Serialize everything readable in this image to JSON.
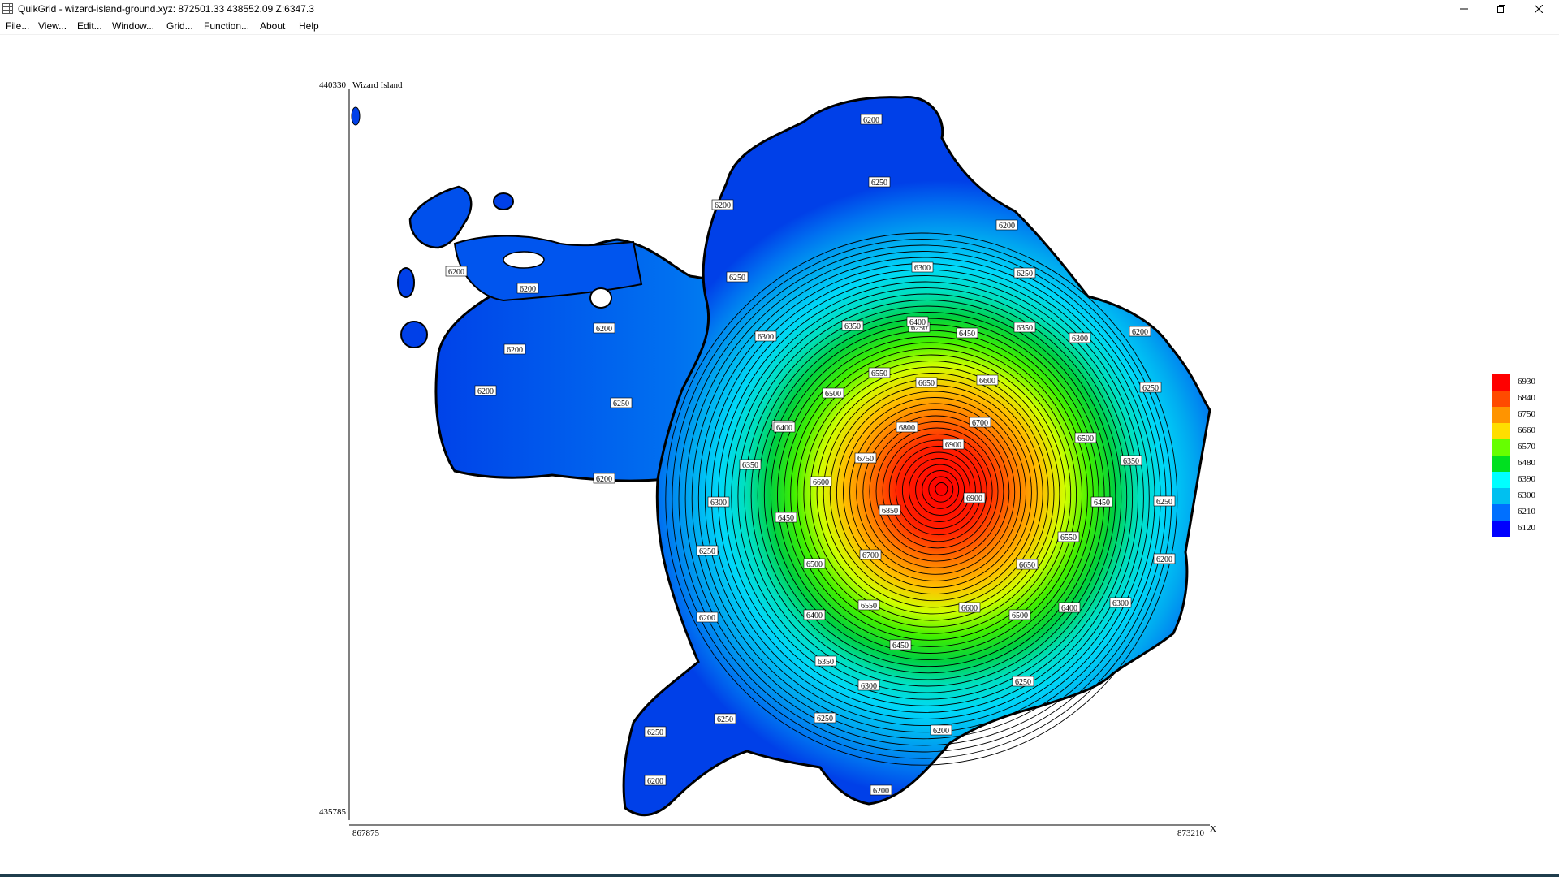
{
  "window": {
    "title": "QuikGrid - wizard-island-ground.xyz: 872501.33 438552.09 Z:6347.3",
    "app_icon": "grid-icon",
    "controls": {
      "minimize_icon": "minimize-icon",
      "restore_icon": "restore-icon",
      "close_icon": "close-icon"
    }
  },
  "menu": {
    "items": [
      {
        "label": "File...",
        "name": "menu-file"
      },
      {
        "label": "View...",
        "name": "menu-view"
      },
      {
        "label": "Edit...",
        "name": "menu-edit"
      },
      {
        "label": "Window...",
        "name": "menu-window"
      },
      {
        "label": "Grid...",
        "name": "menu-grid"
      },
      {
        "label": "Function...",
        "name": "menu-function"
      },
      {
        "label": "About",
        "name": "menu-about"
      },
      {
        "label": "Help",
        "name": "menu-help"
      }
    ]
  },
  "plot": {
    "title": "Wizard Island",
    "y_max_label": "440330",
    "y_min_label": "435785",
    "x_min_label": "867875",
    "x_max_label": "873210",
    "x_axis_name": "X"
  },
  "legend": {
    "entries": [
      {
        "value": "6930",
        "color": "#ff0000"
      },
      {
        "value": "6840",
        "color": "#ff4a00"
      },
      {
        "value": "6750",
        "color": "#ff9400"
      },
      {
        "value": "6660",
        "color": "#ffde00"
      },
      {
        "value": "6570",
        "color": "#66ff00"
      },
      {
        "value": "6480",
        "color": "#00e020"
      },
      {
        "value": "6390",
        "color": "#00ffff"
      },
      {
        "value": "6300",
        "color": "#00c0f0"
      },
      {
        "value": "6210",
        "color": "#0070ff"
      },
      {
        "value": "6120",
        "color": "#0000ff"
      }
    ]
  },
  "contour_labels": [
    "6200",
    "6250",
    "6200",
    "6200",
    "6250",
    "6300",
    "6250",
    "6200",
    "6200",
    "6200",
    "6200",
    "6250",
    "6300",
    "6350",
    "6400",
    "6450",
    "6350",
    "6300",
    "6200",
    "6200",
    "6250",
    "6550",
    "6650",
    "6600",
    "6400",
    "6250",
    "6500",
    "6800",
    "6700",
    "6500",
    "6400",
    "6900",
    "6350",
    "6750",
    "6350",
    "6600",
    "6900",
    "6450",
    "6200",
    "6300",
    "6450",
    "6850",
    "6550",
    "6250",
    "6250",
    "6500",
    "6700",
    "6650",
    "6200",
    "6400",
    "6550",
    "6600",
    "6500",
    "6400",
    "6300",
    "6350",
    "6450",
    "6200",
    "6300",
    "6250",
    "6250",
    "6250",
    "6200",
    "6250",
    "6200",
    "6200"
  ]
}
